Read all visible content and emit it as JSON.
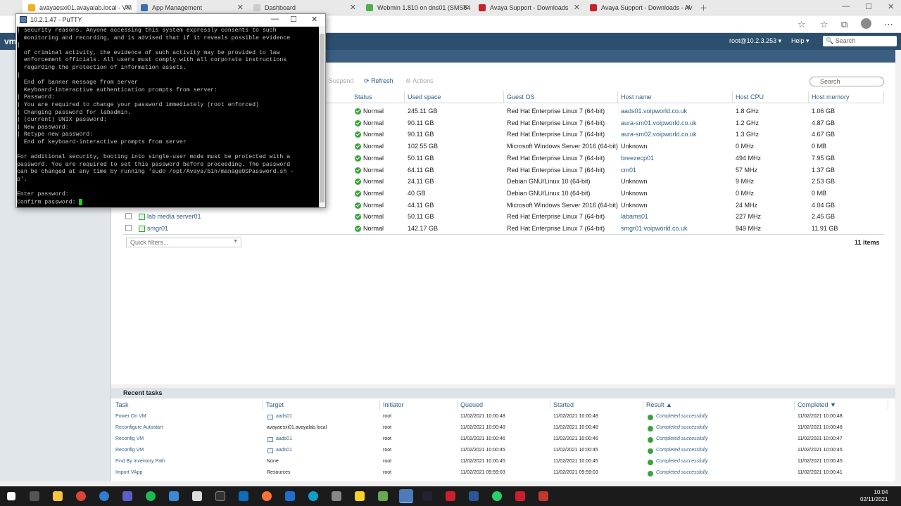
{
  "browser": {
    "tabs": [
      {
        "label": "avayaesxi01.avayalab.local - VM",
        "color": "#f2b01e"
      },
      {
        "label": "App Management",
        "color": "#3a6fb0"
      },
      {
        "label": "Dashboard",
        "color": "#999999"
      },
      {
        "label": "Webmin 1.810 on dns01 (SMS64",
        "color": "#4caf50"
      },
      {
        "label": "Avaya Support - Downloads",
        "color": "#cc1f2d"
      },
      {
        "label": "Avaya Support - Downloads - Av",
        "color": "#cc1f2d"
      }
    ]
  },
  "vsphere": {
    "user": "root@10.2.3.253 ▾",
    "help": "Help ▾",
    "search_placeholder": "Search"
  },
  "toolbar": {
    "suspend": "Suspend",
    "refresh": "Refresh",
    "actions": "Actions",
    "search_placeholder": "Search"
  },
  "grid": {
    "columns": [
      "Status",
      "Used space",
      "Guest OS",
      "Host name",
      "Host CPU",
      "Host memory"
    ],
    "rows": [
      {
        "status": "Normal",
        "used": "245.11 GB",
        "os": "Red Hat Enterprise Linux 7 (64-bit)",
        "host": "aads01.voipworld.co.uk",
        "cpu": "1.8 GHz",
        "mem": "1.06 GB"
      },
      {
        "status": "Normal",
        "used": "90.11 GB",
        "os": "Red Hat Enterprise Linux 7 (64-bit)",
        "host": "aura-sm01.voipworld.co.uk",
        "cpu": "1.2 GHz",
        "mem": "4.87 GB"
      },
      {
        "status": "Normal",
        "used": "90.11 GB",
        "os": "Red Hat Enterprise Linux 7 (64-bit)",
        "host": "aura-sm02.voipworld.co.uk",
        "cpu": "1.3 GHz",
        "mem": "4.67 GB"
      },
      {
        "status": "Normal",
        "used": "102.55 GB",
        "os": "Microsoft Windows Server 2016 (64-bit)",
        "host": "Unknown",
        "cpu": "0 MHz",
        "mem": "0 MB"
      },
      {
        "status": "Normal",
        "used": "50.11 GB",
        "os": "Red Hat Enterprise Linux 7 (64-bit)",
        "host": "breezecp01",
        "cpu": "494 MHz",
        "mem": "7.95 GB"
      },
      {
        "status": "Normal",
        "used": "64.11 GB",
        "os": "Red Hat Enterprise Linux 7 (64-bit)",
        "host": "cm01",
        "cpu": "57 MHz",
        "mem": "1.37 GB"
      },
      {
        "status": "Normal",
        "used": "24.11 GB",
        "os": "Debian GNU/Linux 10 (64-bit)",
        "host": "Unknown",
        "cpu": "9 MHz",
        "mem": "2.53 GB"
      },
      {
        "status": "Normal",
        "used": "40 GB",
        "os": "Debian GNU/Linux 10 (64-bit)",
        "host": "Unknown",
        "cpu": "0 MHz",
        "mem": "0 MB"
      },
      {
        "status": "Normal",
        "used": "44.11 GB",
        "os": "Microsoft Windows Server 2016 (64-bit)",
        "host": "Unknown",
        "cpu": "24 MHz",
        "mem": "4.04 GB"
      },
      {
        "name": "lab media server01",
        "status": "Normal",
        "used": "50.11 GB",
        "os": "Red Hat Enterprise Linux 7 (64-bit)",
        "host": "labams01",
        "cpu": "227 MHz",
        "mem": "2.45 GB"
      },
      {
        "name": "smgr01",
        "status": "Normal",
        "used": "142.17 GB",
        "os": "Red Hat Enterprise Linux 7 (64-bit)",
        "host": "smgr01.voipworld.co.uk",
        "cpu": "949 MHz",
        "mem": "11.91 GB"
      }
    ],
    "quick_filters": "Quick filters...",
    "item_count": "11 items"
  },
  "recent_tasks": {
    "title": "Recent tasks",
    "columns": [
      "Task",
      "Target",
      "Initiator",
      "Queued",
      "Started",
      "Result ▲",
      "Completed ▼"
    ],
    "rows": [
      {
        "task": "Power On VM",
        "target": "aads01",
        "init": "root",
        "queued": "11/02/2021 10:00:48",
        "started": "11/02/2021 10:00:48",
        "result": "Completed successfully",
        "completed": "11/02/2021 10:00:48"
      },
      {
        "task": "Reconfigure Autostart",
        "target": "avayaesxi01.avayalab.local",
        "init": "root",
        "queued": "11/02/2021 10:00:48",
        "started": "11/02/2021 10:00:48",
        "result": "Completed successfully",
        "completed": "11/02/2021 10:00:48"
      },
      {
        "task": "Reconfig VM",
        "target": "aads01",
        "init": "root",
        "queued": "11/02/2021 10:00:46",
        "started": "11/02/2021 10:00:46",
        "result": "Completed successfully",
        "completed": "11/02/2021 10:00:47"
      },
      {
        "task": "Reconfig VM",
        "target": "aads01",
        "init": "root",
        "queued": "11/02/2021 10:00:45",
        "started": "11/02/2021 10:00:45",
        "result": "Completed successfully",
        "completed": "11/02/2021 10:00:45"
      },
      {
        "task": "Find By Inventory Path",
        "target": "None",
        "init": "root",
        "queued": "11/02/2021 10:00:45",
        "started": "11/02/2021 10:00:45",
        "result": "Completed successfully",
        "completed": "11/02/2021 10:00:45"
      },
      {
        "task": "Import VApp",
        "target": "Resources",
        "init": "root",
        "queued": "11/02/2021 09:59:03",
        "started": "11/02/2021 09:59:03",
        "result": "Completed successfully",
        "completed": "11/02/2021 10:00:41"
      }
    ]
  },
  "putty": {
    "title": "10.2.1.47 - PuTTY",
    "terminal": "| security reasons. Anyone accessing this system expressly consents to such\n  monitoring and recording, and is advised that if it reveals possible evidence\n|\n  of criminal activity, the evidence of such activity may be provided to law\n  enforcement officials. All users must comply with all corporate instructions\n  regarding the protection of information assets.\n|\n  End of banner message from server\n  Keyboard-interactive authentication prompts from server:\n| Password:\n| You are required to change your password immediately (root enforced)\n| Changing password for labadmin.\n| (current) UNIX password:\n| New password:\n| Retype new password:\n  End of keyboard-interactive prompts from server\n\nFor additional security, booting into single-user mode must be protected with a\npassword. You are required to set this password before proceeding. The password\ncan be changed at any time by running 'sudo /opt/Avaya/bin/manageOSPassword.sh -\np'.\n\nEnter password:\nConfirm password: "
  },
  "taskbar": {
    "time": "10:04",
    "date": "02/11/2021"
  }
}
